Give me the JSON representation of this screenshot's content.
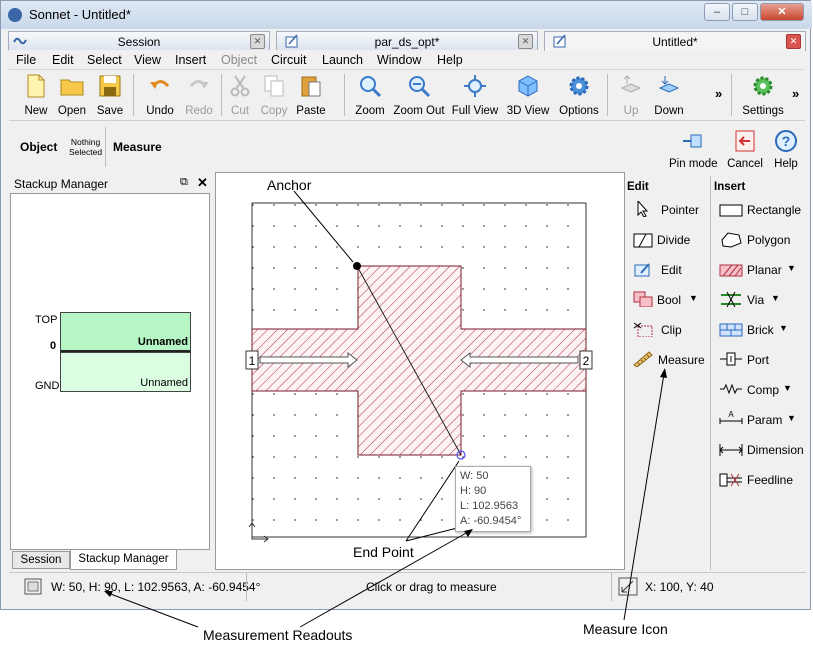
{
  "window": {
    "title": "Sonnet - Untitled*",
    "tabs": [
      {
        "label": "Session"
      },
      {
        "label": "par_ds_opt*"
      },
      {
        "label": "Untitled*"
      }
    ]
  },
  "menu": [
    "File",
    "Edit",
    "Select",
    "View",
    "Insert",
    "Object",
    "Circuit",
    "Launch",
    "Window",
    "Help"
  ],
  "toolbar": {
    "new": "New",
    "open": "Open",
    "save": "Save",
    "undo": "Undo",
    "redo": "Redo",
    "cut": "Cut",
    "copy": "Copy",
    "paste": "Paste",
    "zoom": "Zoom",
    "zoom_out": "Zoom Out",
    "full_view": "Full View",
    "view_3d": "3D View",
    "options": "Options",
    "up": "Up",
    "down": "Down",
    "more": "»",
    "settings": "Settings"
  },
  "objbar": {
    "object": "Object",
    "nothing_selected_1": "Nothing",
    "nothing_selected_2": "Selected",
    "measure": "Measure",
    "pin_mode": "Pin mode",
    "cancel": "Cancel",
    "help": "Help"
  },
  "stackup": {
    "title": "Stackup Manager",
    "top": "TOP",
    "zero": "0",
    "gnd": "GND",
    "layer1": "Unnamed",
    "layer2": "Unnamed",
    "bottom_tabs": [
      "Session",
      "Stackup Manager"
    ]
  },
  "canvas": {
    "port1": "1",
    "port2": "2",
    "tooltip": [
      "W: 50",
      "H: 90",
      "L: 102.9563",
      "A: -60.9454°"
    ]
  },
  "edit_panel": {
    "title": "Edit",
    "items": [
      "Pointer",
      "Divide",
      "Edit",
      "Bool",
      "Clip",
      "Measure"
    ]
  },
  "insert_panel": {
    "title": "Insert",
    "items": [
      "Rectangle",
      "Polygon",
      "Planar",
      "Via",
      "Brick",
      "Port",
      "Comp",
      "Param",
      "Dimension",
      "Feedline"
    ]
  },
  "status": {
    "readout": "W: 50, H: 90, L: 102.9563, A: -60.9454°",
    "hint": "Click or drag to measure",
    "coords": "X: 100, Y: 40"
  },
  "callouts": {
    "anchor": "Anchor",
    "end_point": "End Point",
    "measurement_readouts": "Measurement Readouts",
    "measure_icon": "Measure Icon"
  },
  "colors": {
    "metal_hatch": "#b03040",
    "stackup_fill": "#b6f5c4",
    "accent": "#3a66a8"
  }
}
